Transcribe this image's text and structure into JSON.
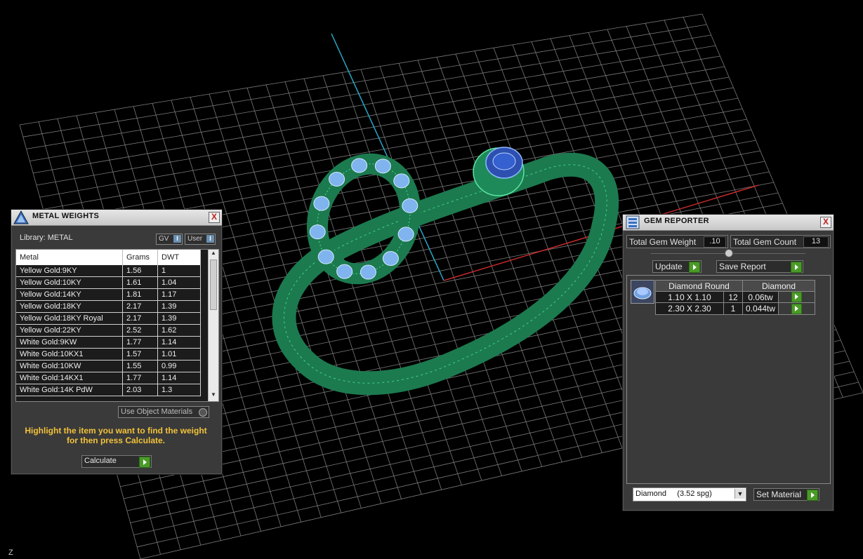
{
  "metal_weights": {
    "title": "METAL WEIGHTS",
    "close": "X",
    "library_label": "Library: METAL",
    "toggle_gv": "GV",
    "toggle_user": "User",
    "toggle_knob": "I",
    "columns": [
      "Metal",
      "Grams",
      "DWT"
    ],
    "rows": [
      {
        "metal": "Yellow Gold:9KY",
        "grams": "1.56",
        "dwt": "1"
      },
      {
        "metal": "Yellow Gold:10KY",
        "grams": "1.61",
        "dwt": "1.04"
      },
      {
        "metal": "Yellow Gold:14KY",
        "grams": "1.81",
        "dwt": "1.17"
      },
      {
        "metal": "Yellow Gold:18KY",
        "grams": "2.17",
        "dwt": "1.39"
      },
      {
        "metal": "Yellow Gold:18KY Royal",
        "grams": "2.17",
        "dwt": "1.39"
      },
      {
        "metal": "Yellow Gold:22KY",
        "grams": "2.52",
        "dwt": "1.62"
      },
      {
        "metal": "White Gold:9KW",
        "grams": "1.77",
        "dwt": "1.14"
      },
      {
        "metal": "White Gold:10KX1",
        "grams": "1.57",
        "dwt": "1.01"
      },
      {
        "metal": "White Gold:10KW",
        "grams": "1.55",
        "dwt": "0.99"
      },
      {
        "metal": "White Gold:14KX1",
        "grams": "1.77",
        "dwt": "1.14"
      },
      {
        "metal": "White Gold:14K PdW",
        "grams": "2.03",
        "dwt": "1.3"
      }
    ],
    "use_object_materials": "Use Object Materials",
    "instruction": "Highlight the item you want to find the weight for then press Calculate.",
    "calculate": "Calculate"
  },
  "gem_reporter": {
    "title": "GEM REPORTER",
    "close": "X",
    "total_weight_label": "Total Gem Weight",
    "total_weight_value": ".10",
    "total_count_label": "Total Gem Count",
    "total_count_value": "13",
    "update": "Update",
    "save_report": "Save Report",
    "header_shape": "Diamond Round",
    "header_material": "Diamond",
    "rows": [
      {
        "size": "1.10 X 1.10",
        "count": "12",
        "weight": "0.06tw"
      },
      {
        "size": "2.30 X 2.30",
        "count": "1",
        "weight": "0.044tw"
      }
    ],
    "material_select": "Diamond     (3.52 spg)",
    "set_material": "Set Material"
  },
  "axis_label": "Z",
  "colors": {
    "ring": "#1e8a5a",
    "gem": "#6fa8e8",
    "panel": "#3a3a3a",
    "accent_arrow": "#4a9a28",
    "grid": "#8a8a8a"
  }
}
